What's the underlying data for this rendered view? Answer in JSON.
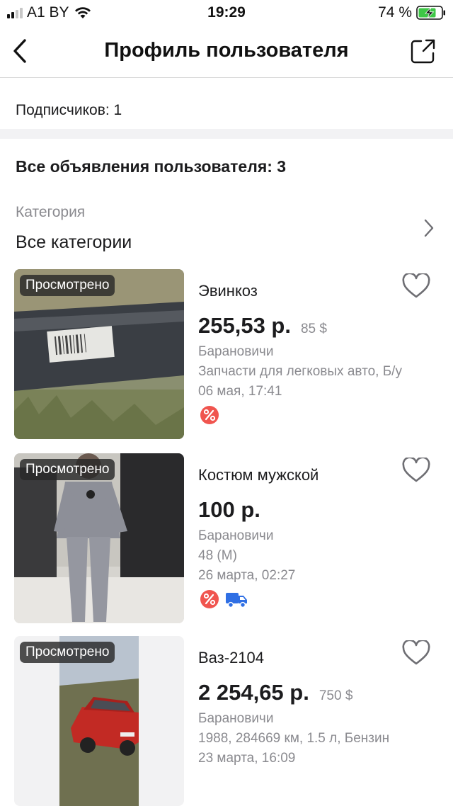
{
  "status_bar": {
    "carrier": "A1 BY",
    "time": "19:29",
    "battery": "74 %"
  },
  "nav": {
    "title": "Профиль пользователя",
    "back_icon": "chevron-left-icon",
    "share_icon": "share-icon"
  },
  "profile": {
    "subscribers": "Подписчиков: 1",
    "all_ads": "Все объявления пользователя: 3"
  },
  "category": {
    "label": "Категория",
    "value": "Все категории"
  },
  "listings": [
    {
      "badge": "Просмотрено",
      "title": "Эвинкоз",
      "price": "255,53 р.",
      "price_alt": "85 $",
      "city": "Барановичи",
      "details": "Запчасти для легковых авто, Б/у",
      "date": "06 мая, 17:41",
      "icons": [
        "discount-icon"
      ]
    },
    {
      "badge": "Просмотрено",
      "title": "Костюм мужской",
      "price": "100 р.",
      "price_alt": "",
      "city": "Барановичи",
      "details": "48 (M)",
      "date": "26 марта, 02:27",
      "icons": [
        "discount-icon",
        "delivery-truck-icon"
      ]
    },
    {
      "badge": "Просмотрено",
      "title": "Ваз-2104",
      "price": "2 254,65 р.",
      "price_alt": "750 $",
      "city": "Барановичи",
      "details": "1988, 284669 км, 1.5 л, Бензин",
      "date": "23 марта, 16:09",
      "icons": []
    }
  ],
  "colors": {
    "discount_badge": "#f0554f",
    "delivery_badge": "#2f6fe4",
    "secondary_text": "#8a8a8f",
    "section_band": "#f2f2f4"
  }
}
